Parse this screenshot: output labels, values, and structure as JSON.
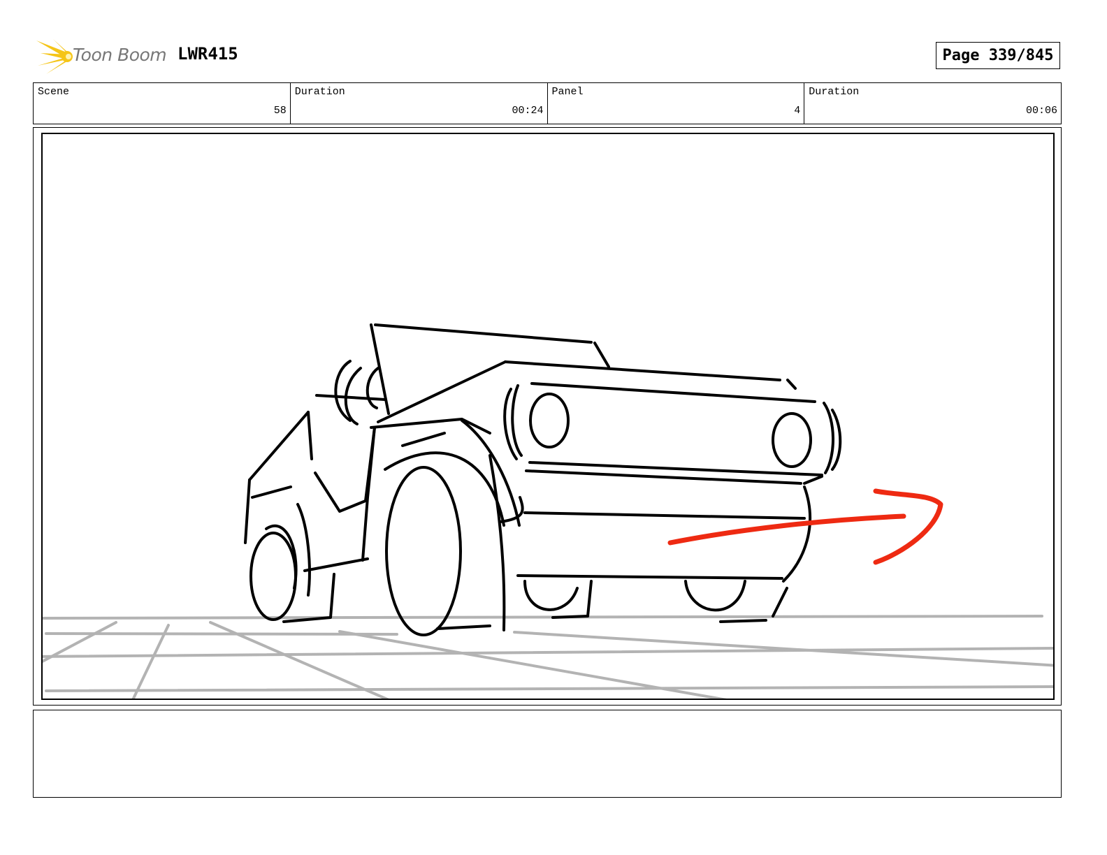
{
  "header": {
    "logo_text": "Toon Boom",
    "project_code": "LWR415",
    "page_label": "Page 339/845"
  },
  "info": {
    "scene_label": "Scene",
    "scene_value": "58",
    "scene_duration_label": "Duration",
    "scene_duration_value": "00:24",
    "panel_label": "Panel",
    "panel_value": "4",
    "panel_duration_label": "Duration",
    "panel_duration_value": "00:06"
  },
  "colors": {
    "logo_yellow": "#f5c518",
    "logo_text": "#777777",
    "sketch_line": "#000000",
    "ground_line": "#b3b3b3",
    "arrow_red": "#ee2a12"
  },
  "notes": {
    "action_text": ""
  }
}
